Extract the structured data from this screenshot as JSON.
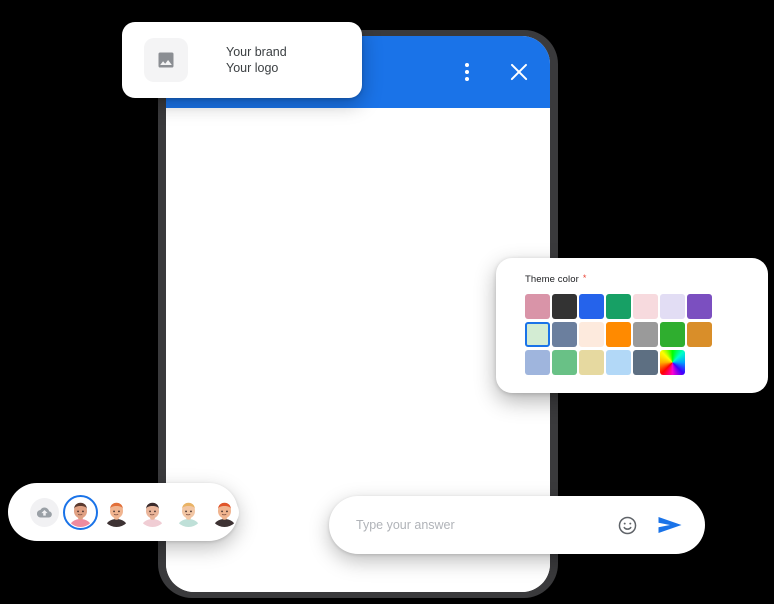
{
  "background_color": "#000000",
  "brand_card": {
    "name": "brand-card",
    "thumbnail_icon": "image-placeholder-icon",
    "line1": "Your brand",
    "line2": "Your logo"
  },
  "phone": {
    "header": {
      "background_color": "#1a73e8",
      "menu_icon": "three-dot-menu-icon",
      "close_icon": "close-icon"
    },
    "body_background": "#ffffff"
  },
  "theme_panel": {
    "label": "Theme color",
    "required_marker": "*",
    "required_color": "#ea4335",
    "selected_index": 7,
    "swatches": [
      {
        "index": 0,
        "color": "#d994a8",
        "name": "dusty-rose"
      },
      {
        "index": 1,
        "color": "#333333",
        "name": "charcoal"
      },
      {
        "index": 2,
        "color": "#2563eb",
        "name": "blue"
      },
      {
        "index": 3,
        "color": "#17a065",
        "name": "emerald"
      },
      {
        "index": 4,
        "color": "#f7dade",
        "name": "blush-pink"
      },
      {
        "index": 5,
        "color": "#e2ddf4",
        "name": "lavender-pale"
      },
      {
        "index": 6,
        "color": "#7b4fc0",
        "name": "purple"
      },
      {
        "index": 7,
        "color": "#d3ecd3",
        "name": "mint-pale"
      },
      {
        "index": 8,
        "color": "#6b7f9e",
        "name": "slate-blue"
      },
      {
        "index": 9,
        "color": "#fdeadd",
        "name": "peach-pale"
      },
      {
        "index": 10,
        "color": "#ff8a00",
        "name": "orange"
      },
      {
        "index": 11,
        "color": "#9a9a9a",
        "name": "grey"
      },
      {
        "index": 12,
        "color": "#2fae2f",
        "name": "green"
      },
      {
        "index": 13,
        "color": "#d98e29",
        "name": "amber-dark"
      },
      {
        "index": 14,
        "color": "#9fb5dd",
        "name": "periwinkle"
      },
      {
        "index": 15,
        "color": "#69c186",
        "name": "sea-green"
      },
      {
        "index": 16,
        "color": "#e6d9a0",
        "name": "sand"
      },
      {
        "index": 17,
        "color": "#b2d8f7",
        "name": "sky-blue"
      },
      {
        "index": 18,
        "color": "#5d6f82",
        "name": "steel"
      },
      {
        "index": 19,
        "color": "rainbow",
        "name": "custom-color-picker"
      }
    ]
  },
  "answer_bar": {
    "placeholder": "Type your answer",
    "value": "",
    "emoji_icon": "smiley-icon",
    "send_icon": "send-icon",
    "send_color": "#1a73e8"
  },
  "avatar_bar": {
    "upload_icon": "cloud-upload-icon",
    "selected_index": 0,
    "avatars": [
      {
        "index": 0,
        "name": "avatar-option-1",
        "hair": "#5b3a2e",
        "skin": "#e0a183",
        "shirt": "#ef8ba0"
      },
      {
        "index": 1,
        "name": "avatar-option-2",
        "hair": "#e2703a",
        "skin": "#f0b48f",
        "shirt": "#3d3233"
      },
      {
        "index": 2,
        "name": "avatar-option-3",
        "hair": "#3b2b2b",
        "skin": "#eab59a",
        "shirt": "#f0cdd4"
      },
      {
        "index": 3,
        "name": "avatar-option-4",
        "hair": "#e9b365",
        "skin": "#f2c6a4",
        "shirt": "#bfe0d8"
      },
      {
        "index": 4,
        "name": "avatar-option-5",
        "hair": "#e0552a",
        "skin": "#f0b48f",
        "shirt": "#3d3233"
      }
    ]
  }
}
